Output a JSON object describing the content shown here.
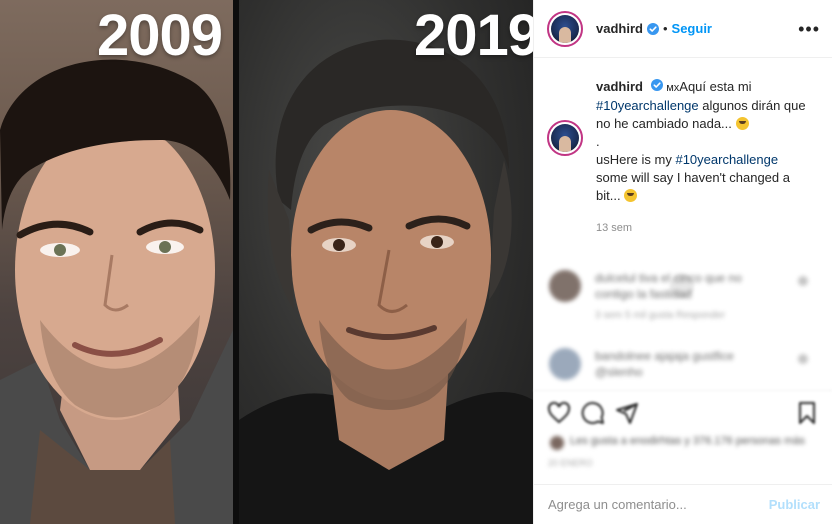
{
  "photo": {
    "left_year": "2009",
    "right_year": "2019"
  },
  "header": {
    "username": "vadhird",
    "separator": "•",
    "follow_label": "Seguir",
    "more_icon": "more-options-icon"
  },
  "caption": {
    "username": "vadhird",
    "flag_mx": "мх",
    "text_es_1": "Aquí esta mi ",
    "tag_es": "#10yearchallenge",
    "text_es_2": " algunos dirán que no he cambiado nada...",
    "dot": ".",
    "flag_us": "us",
    "text_en_1": "Here is my ",
    "tag_en": "#10yearchallenge",
    "text_en_2": " some will say I haven't changed a bit...",
    "time": "13 sem"
  },
  "comments": [
    {
      "text": "dulcelul tiva el cinco que no contigo la fastidad",
      "meta": "3 sem    5 mil gusta    Responder"
    },
    {
      "text": "bandolnee ajajaja gustfice @slenho",
      "meta": ""
    }
  ],
  "likes": {
    "text": "Les gusta a enodirhtas y 376.176 personas más",
    "date": "20 ENERO"
  },
  "add_comment": {
    "placeholder": "Agrega un comentario...",
    "publish_label": "Publicar"
  },
  "colors": {
    "link": "#0095f6",
    "hashtag": "#00376b",
    "publish_disabled": "#b2dffc",
    "border": "#efefef",
    "muted": "#8e8e8e"
  }
}
